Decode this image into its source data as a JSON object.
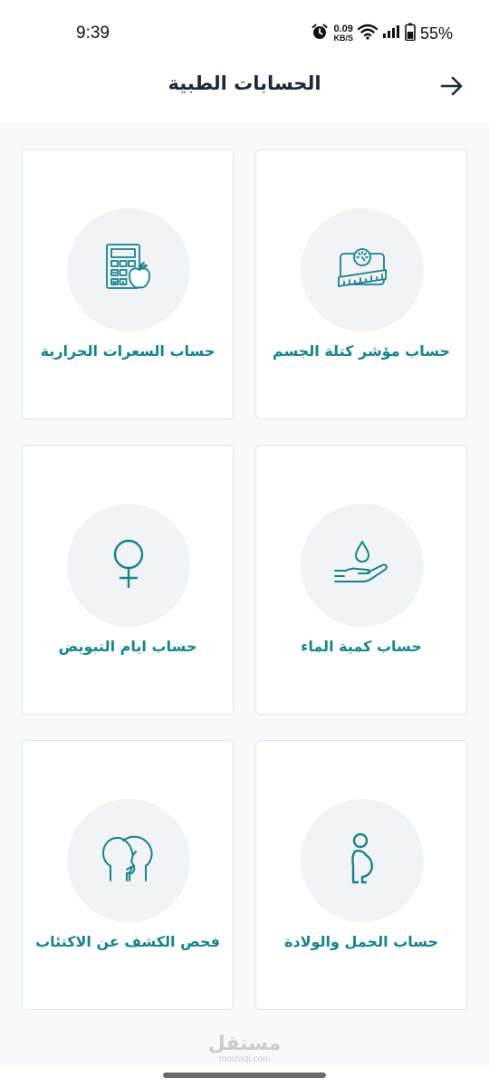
{
  "status_bar": {
    "time": "9:39",
    "net_speed_value": "0.09",
    "net_speed_unit": "KB/S",
    "battery": "55%",
    "icons": [
      "alarm-icon",
      "wifi-icon",
      "signal-icon",
      "battery-icon"
    ]
  },
  "header": {
    "title": "الحسابات الطبية",
    "back_icon": "arrow-right-icon"
  },
  "cards": [
    {
      "label": "حساب مؤشر كتلة الجسم",
      "icon": "scale-tape-icon"
    },
    {
      "label": "حساب السعرات الحرارية",
      "icon": "calculator-apple-icon"
    },
    {
      "label": "حساب كمية الماء",
      "icon": "water-drop-hand-icon"
    },
    {
      "label": "حساب ايام التبويض",
      "icon": "female-symbol-icon"
    },
    {
      "label": "حساب الحمل والولادة",
      "icon": "pregnant-woman-icon"
    },
    {
      "label": "فحص الكشف عن الاكتئاب",
      "icon": "two-heads-icon"
    }
  ],
  "watermark": {
    "main": "مستقل",
    "sub": "mostaql.com"
  },
  "colors": {
    "accent": "#16838c",
    "background": "#f8f9fb",
    "card": "#ffffff",
    "circle": "#f2f3f5"
  }
}
